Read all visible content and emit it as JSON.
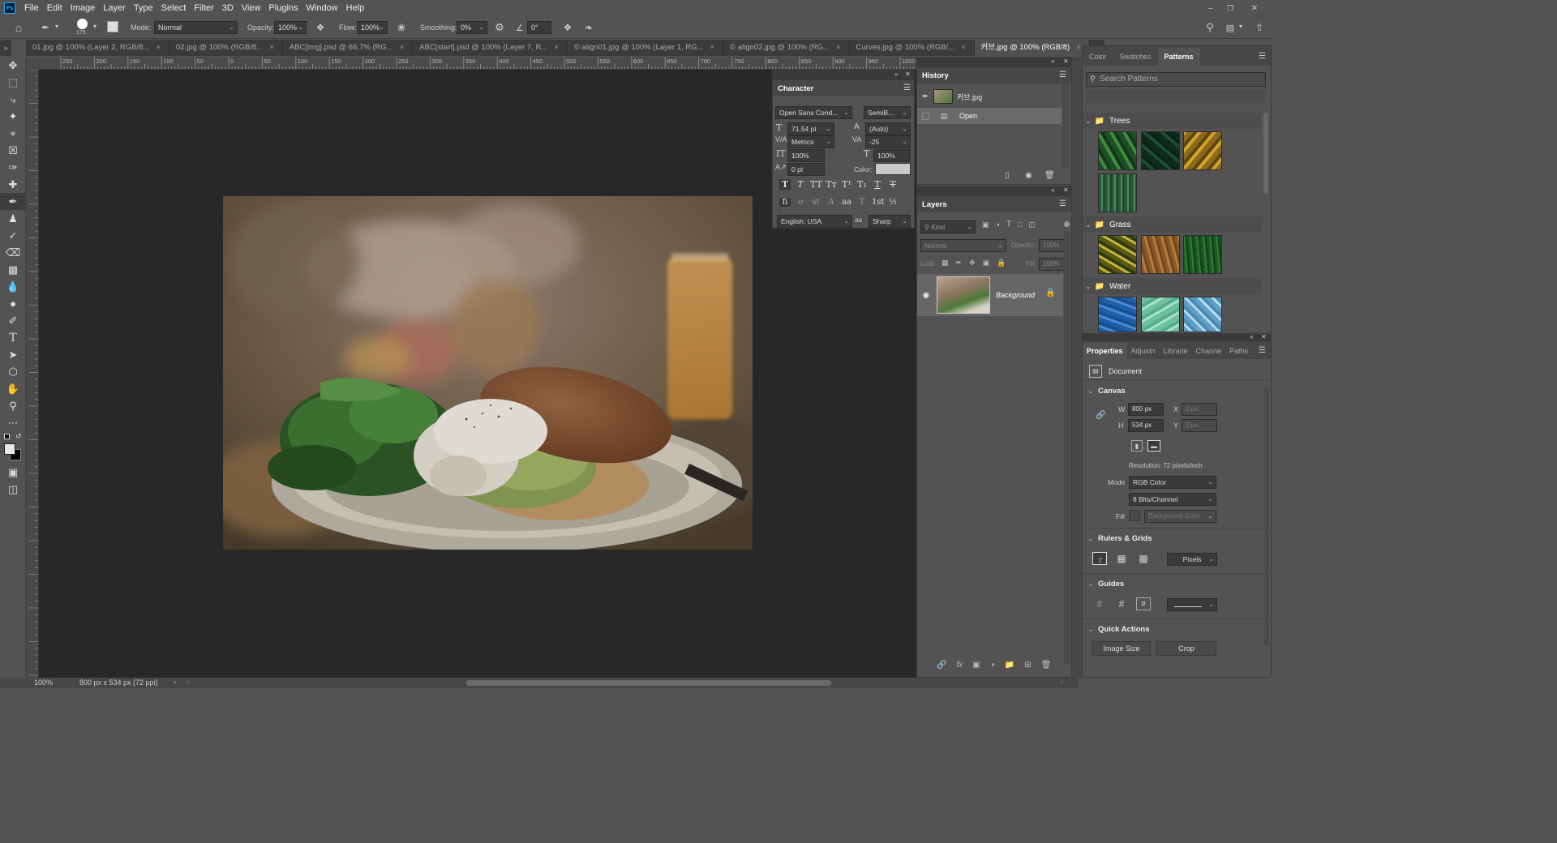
{
  "menu": {
    "app_icon": "Ps",
    "items": [
      "File",
      "Edit",
      "Image",
      "Layer",
      "Type",
      "Select",
      "Filter",
      "3D",
      "View",
      "Plugins",
      "Window",
      "Help"
    ]
  },
  "options": {
    "brush_size": "175",
    "mode_label": "Mode:",
    "mode_value": "Normal",
    "opacity_label": "Opacity:",
    "opacity_value": "100%",
    "flow_label": "Flow:",
    "flow_value": "100%",
    "smoothing_label": "Smoothing:",
    "smoothing_value": "0%",
    "angle_value": "0°"
  },
  "tabs": [
    {
      "label": "01.jpg @ 100% (Layer 2, RGB/8..."
    },
    {
      "label": "02.jpg @ 100% (RGB/8..."
    },
    {
      "label": "ABC[img].psd @ 66.7% (RG..."
    },
    {
      "label": "ABC[start].psd @ 100% (Layer 7, R..."
    },
    {
      "label": "© align01.jpg @ 100% (Layer 1, RG..."
    },
    {
      "label": "© align02.jpg @ 100% (RG..."
    },
    {
      "label": "Curves.jpg @ 100% (RGB/..."
    },
    {
      "label": "커브.jpg @ 100% (RGB/8)"
    }
  ],
  "ruler": {
    "h_ticks": [
      "250",
      "200",
      "150",
      "100",
      "50",
      "0",
      "50",
      "100",
      "150",
      "200",
      "250",
      "300",
      "350",
      "400",
      "450",
      "500",
      "550",
      "600",
      "650",
      "700",
      "750",
      "800",
      "850",
      "900",
      "950",
      "1000"
    ]
  },
  "status": {
    "zoom": "100%",
    "doc_info": "800 px x 534 px (72 ppi)"
  },
  "character": {
    "title": "Character",
    "font_family": "Open Sans Cond...",
    "font_style": "SemiB...",
    "size": "71.54 pt",
    "leading": "(Auto)",
    "kerning": "Metrics",
    "tracking": "-25",
    "vscale": "100%",
    "hscale": "100%",
    "baseline": "0 pt",
    "color_label": "Color:",
    "language": "English: USA",
    "aa_icon": "aa",
    "antialias": "Sharp"
  },
  "history": {
    "title": "History",
    "snapshot": "커브.jpg",
    "step": "Open"
  },
  "layers": {
    "title": "Layers",
    "kind_placeholder": "Kind",
    "blend": "Normal",
    "opacity_label": "Opacity:",
    "opacity_value": "100%",
    "lock_label": "Lock:",
    "fill_label": "Fill:",
    "fill_value": "100%",
    "layer_name": "Background"
  },
  "right_top": {
    "tabs": [
      "Color",
      "Swatches",
      "Patterns"
    ],
    "search_placeholder": "Search Patterns",
    "groups": [
      {
        "name": "Trees"
      },
      {
        "name": "Grass"
      },
      {
        "name": "Water"
      }
    ]
  },
  "properties": {
    "tabs": [
      "Properties",
      "Adjustn",
      "Librarie",
      "Channe",
      "Paths"
    ],
    "document": "Document",
    "canvas_title": "Canvas",
    "w_label": "W",
    "w_value": "800 px",
    "h_label": "H",
    "h_value": "534 px",
    "x_label": "X",
    "x_value": "0 px",
    "y_label": "Y",
    "y_value": "0 px",
    "resolution": "Resolution: 72 pixels/inch",
    "mode_label": "Mode",
    "mode_value": "RGB Color",
    "bits_value": "8 Bits/Channel",
    "fill_label": "Fill",
    "fill_value": "Background Color",
    "rulers_title": "Rulers & Grids",
    "units": "Pixels",
    "guides_title": "Guides",
    "quick_title": "Quick Actions",
    "image_size": "Image Size",
    "crop": "Crop"
  }
}
